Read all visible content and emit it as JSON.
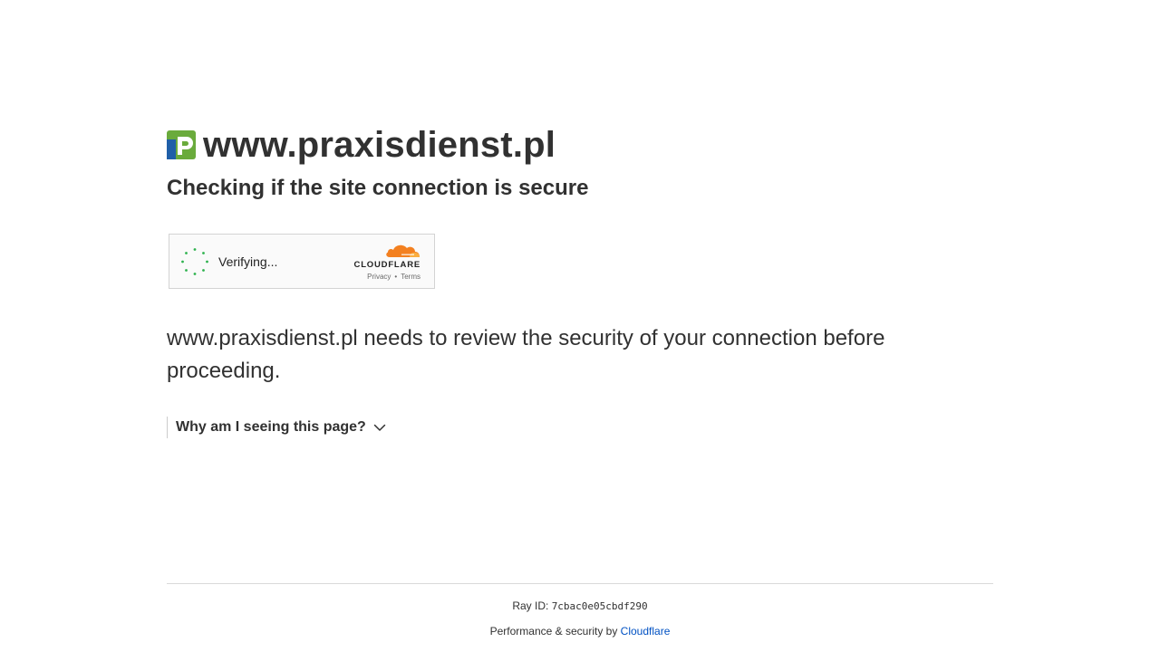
{
  "header": {
    "site_name": "www.praxisdienst.pl",
    "logo_icon": "praxisdienst-logo-icon",
    "subheading": "Checking if the site connection is secure"
  },
  "widget": {
    "status_text": "Verifying...",
    "spinner_icon": "loading-spinner-icon",
    "brand": "CLOUDFLARE",
    "brand_icon": "cloudflare-cloud-icon",
    "privacy_label": "Privacy",
    "separator": "•",
    "terms_label": "Terms"
  },
  "main": {
    "description": "www.praxisdienst.pl needs to review the security of your connection before proceeding.",
    "why_label": "Why am I seeing this page?",
    "why_icon": "chevron-down-icon"
  },
  "footer": {
    "ray_label": "Ray ID: ",
    "ray_id": "7cbac0e05cbdf290",
    "performance_prefix": "Performance & security by ",
    "performance_link": "Cloudflare"
  },
  "colors": {
    "text": "#313131",
    "link": "#0051c3",
    "logo_green": "#6aab3c",
    "logo_blue": "#1f5fa8",
    "cloudflare_orange": "#f38020",
    "spinner_green": "#2eb24e"
  }
}
